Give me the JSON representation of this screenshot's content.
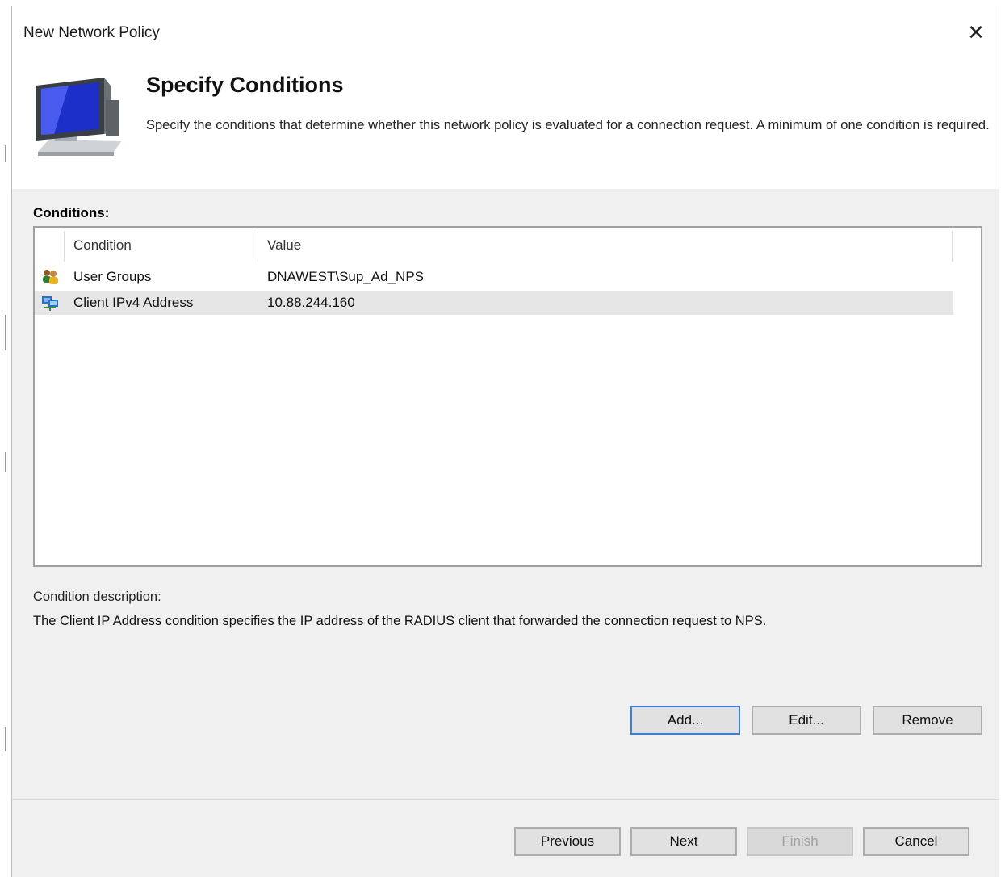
{
  "window": {
    "title": "New Network Policy",
    "close_glyph": "✕"
  },
  "header": {
    "heading": "Specify Conditions",
    "description": "Specify the conditions that determine whether this network policy is evaluated for a connection request. A minimum of one condition is required."
  },
  "conditions": {
    "label": "Conditions:",
    "columns": {
      "condition": "Condition",
      "value": "Value"
    },
    "rows": [
      {
        "condition": "User Groups",
        "value": "DNAWEST\\Sup_Ad_NPS",
        "icon": "user-groups-icon"
      },
      {
        "condition": "Client IPv4 Address",
        "value": "10.88.244.160",
        "icon": "network-computer-icon",
        "selected": true
      }
    ]
  },
  "description": {
    "label": "Condition description:",
    "text": "The Client IP Address condition specifies the IP address of the RADIUS client that forwarded the connection request to NPS."
  },
  "actions": {
    "add": "Add...",
    "edit": "Edit...",
    "remove": "Remove"
  },
  "footer": {
    "previous": "Previous",
    "next": "Next",
    "finish": "Finish",
    "cancel": "Cancel"
  },
  "colors": {
    "dialog_bg": "#f0f0f0",
    "header_bg": "#ffffff",
    "default_button_border": "#3c7fd6",
    "selected_row": "#e6e6e6"
  }
}
